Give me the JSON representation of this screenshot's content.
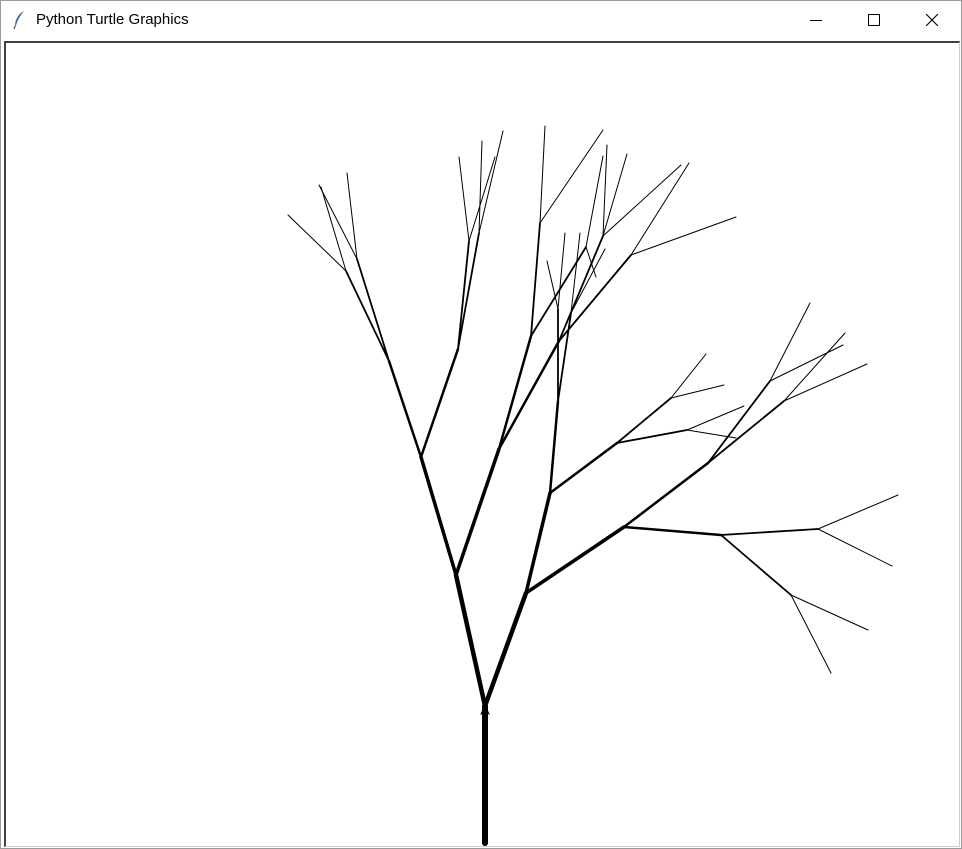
{
  "window": {
    "title": "Python Turtle Graphics",
    "icon": "feather-icon",
    "controls": [
      "minimize-icon",
      "maximize-icon",
      "close-icon"
    ]
  },
  "canvas": {
    "background": "#ffffff",
    "stroke_color": "#000000",
    "turtle_cursor": "classic-arrow"
  }
}
